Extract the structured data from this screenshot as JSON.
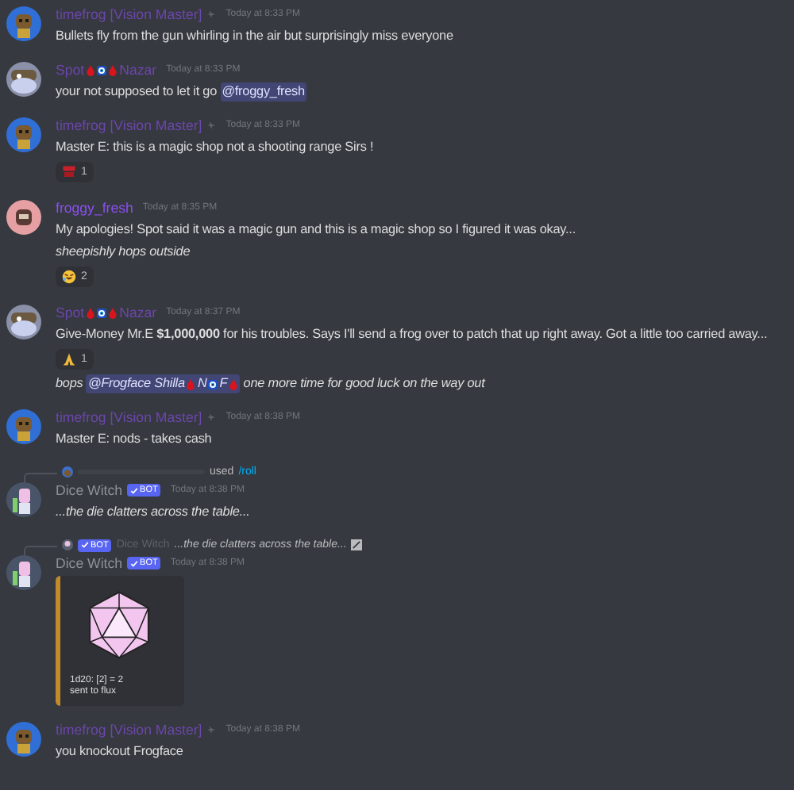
{
  "messages": [
    {
      "avatar": {
        "kind": "frog"
      },
      "author": [
        {
          "kind": "text",
          "text": "timefrog [Vision Master]"
        }
      ],
      "color": "#6c46ad",
      "role_icon": true,
      "time": "Today at 8:33 PM",
      "lines": [
        {
          "kind": "text",
          "segments": [
            {
              "kind": "text",
              "text": "Bullets fly from the gun whirling in the air but surprisingly miss everyone"
            }
          ]
        }
      ]
    },
    {
      "avatar": {
        "kind": "spot"
      },
      "author": [
        {
          "kind": "text",
          "text": "Spot"
        },
        {
          "kind": "drop"
        },
        {
          "kind": "eye"
        },
        {
          "kind": "drop"
        },
        {
          "kind": "text",
          "text": "Nazar"
        }
      ],
      "color": "#6c46ad",
      "time": "Today at 8:33 PM",
      "lines": [
        {
          "kind": "text",
          "segments": [
            {
              "kind": "text",
              "text": "your not supposed to let it go "
            },
            {
              "kind": "mention",
              "text": "@froggy_fresh"
            }
          ]
        }
      ]
    },
    {
      "avatar": {
        "kind": "frog"
      },
      "author": [
        {
          "kind": "text",
          "text": "timefrog [Vision Master]"
        }
      ],
      "color": "#6c46ad",
      "role_icon": true,
      "time": "Today at 8:33 PM",
      "lines": [
        {
          "kind": "text",
          "segments": [
            {
              "kind": "text",
              "text": "Master E: this is a magic shop not a shooting range Sirs !"
            }
          ]
        },
        {
          "kind": "reaction",
          "emoji": {
            "kind": "sticker"
          },
          "count": "1"
        }
      ]
    },
    {
      "avatar": {
        "kind": "froggy"
      },
      "author": [
        {
          "kind": "text",
          "text": "froggy_fresh"
        }
      ],
      "color": "#8a50f0",
      "time": "Today at 8:35 PM",
      "lines": [
        {
          "kind": "text",
          "segments": [
            {
              "kind": "text",
              "text": "My apologies! Spot said it was a magic gun and this is a magic shop so I figured it was okay..."
            }
          ]
        },
        {
          "kind": "text",
          "italic": true,
          "segments": [
            {
              "kind": "text",
              "text": "sheepishly hops outside"
            }
          ]
        },
        {
          "kind": "reaction",
          "emoji": {
            "kind": "laugh"
          },
          "count": "2"
        }
      ]
    },
    {
      "avatar": {
        "kind": "spot"
      },
      "author": [
        {
          "kind": "text",
          "text": "Spot"
        },
        {
          "kind": "drop"
        },
        {
          "kind": "eye"
        },
        {
          "kind": "drop"
        },
        {
          "kind": "text",
          "text": "Nazar"
        }
      ],
      "color": "#6c46ad",
      "time": "Today at 8:37 PM",
      "lines": [
        {
          "kind": "text",
          "segments": [
            {
              "kind": "text",
              "text": "Give-Money Mr.E "
            },
            {
              "kind": "bold",
              "text": "$1,000,000"
            },
            {
              "kind": "text",
              "text": " for his troubles. Says I'll send a frog over to patch that up right away. Got a little too carried away..."
            }
          ]
        },
        {
          "kind": "reaction",
          "emoji": {
            "kind": "pray"
          },
          "count": "1"
        },
        {
          "kind": "text",
          "italic": true,
          "segments": [
            {
              "kind": "text",
              "text": "bops "
            },
            {
              "kind": "mention",
              "text": "@Frogface Shilla",
              "tail": [
                {
                  "kind": "drop"
                },
                {
                  "kind": "text",
                  "text": "N"
                },
                {
                  "kind": "eye"
                },
                {
                  "kind": "text",
                  "text": "F"
                },
                {
                  "kind": "drop"
                }
              ]
            },
            {
              "kind": "text",
              "text": " one more time for good luck on the way out"
            }
          ]
        }
      ]
    },
    {
      "avatar": {
        "kind": "frog"
      },
      "author": [
        {
          "kind": "text",
          "text": "timefrog [Vision Master]"
        }
      ],
      "color": "#6c46ad",
      "role_icon": true,
      "time": "Today at 8:38 PM",
      "lines": [
        {
          "kind": "text",
          "segments": [
            {
              "kind": "text",
              "text": "Master E: nods - takes cash"
            }
          ]
        }
      ]
    },
    {
      "avatar": {
        "kind": "witch"
      },
      "reply": {
        "kind": "command",
        "used": "used",
        "command": "/roll"
      },
      "author": [
        {
          "kind": "text",
          "text": "Dice Witch"
        }
      ],
      "color": "#8e9297",
      "bot": "BOT",
      "time": "Today at 8:38 PM",
      "lines": [
        {
          "kind": "text",
          "italic": true,
          "segments": [
            {
              "kind": "text",
              "text": "...the die clatters across the table..."
            }
          ]
        }
      ]
    },
    {
      "avatar": {
        "kind": "witch"
      },
      "reply": {
        "kind": "message",
        "bot": "BOT",
        "author": "Dice Witch",
        "text": "...the die clatters across the table..."
      },
      "author": [
        {
          "kind": "text",
          "text": "Dice Witch"
        }
      ],
      "color": "#8e9297",
      "bot": "BOT",
      "time": "Today at 8:38 PM",
      "lines": [
        {
          "kind": "embed",
          "texts": [
            "1d20: [2] = 2",
            "sent to flux"
          ]
        }
      ]
    },
    {
      "avatar": {
        "kind": "frog"
      },
      "author": [
        {
          "kind": "text",
          "text": "timefrog [Vision Master]"
        }
      ],
      "color": "#6c46ad",
      "role_icon": true,
      "time": "Today at 8:38 PM",
      "lines": [
        {
          "kind": "text",
          "segments": [
            {
              "kind": "text",
              "text": "you knockout Frogface"
            }
          ]
        }
      ]
    }
  ]
}
